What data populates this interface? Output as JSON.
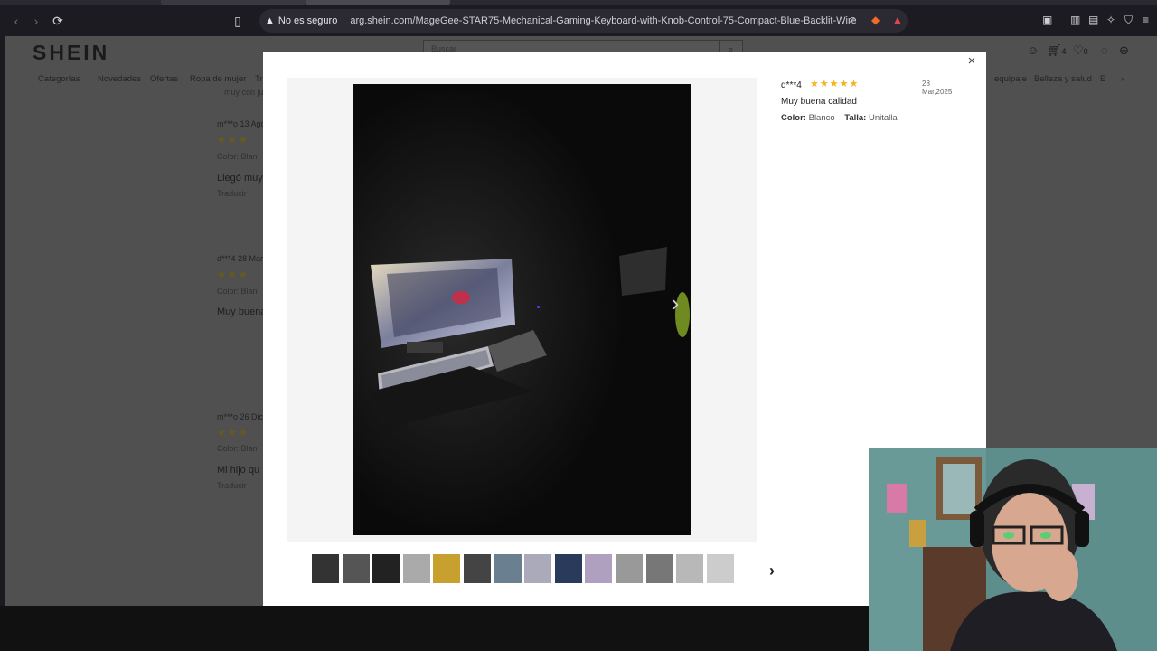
{
  "browser": {
    "security_label": "No es seguro",
    "url": "arg.shein.com/MageGee-STAR75-Mechanical-Gaming-Keyboard-with-Knob-Control-75-Compact-Blue-Backlit-Wired-Gaming-Keyboa...",
    "notification_badge": "1"
  },
  "site": {
    "logo": "SHEIN",
    "search_placeholder": "Buscar",
    "cart_count": "4",
    "wishlist_count": "0",
    "nav": [
      "Categorías",
      "Novedades",
      "Ofertas",
      "Ropa de mujer",
      "Tr",
      "equipaje",
      "Belleza y salud",
      "E"
    ]
  },
  "background_reviews": [
    {
      "name": "m***o",
      "date": "13 Ago",
      "attr": "Color: Blan",
      "text": "Llegó muy",
      "translate": "Traducir"
    },
    {
      "name": "d***4",
      "date": "28 Mar",
      "attr": "Color: Blan",
      "text": "Muy buena",
      "translate": ""
    },
    {
      "name": "m***o",
      "date": "26 Dic",
      "attr": "Color: Blan",
      "text": "Mi hijo qu",
      "translate": "Traducir"
    }
  ],
  "background_snippet": "muy con ju",
  "modal": {
    "reviewer": "d***4",
    "stars": "★★★★★",
    "date": "28 Mar,2025",
    "comment": "Muy buena calidad",
    "color_label": "Color:",
    "color_value": "Blanco",
    "size_label": "Talla:",
    "size_value": "Unitalla",
    "close_icon": "×",
    "next_icon": "›",
    "thumb_count": 14,
    "selected_thumb": 3
  }
}
